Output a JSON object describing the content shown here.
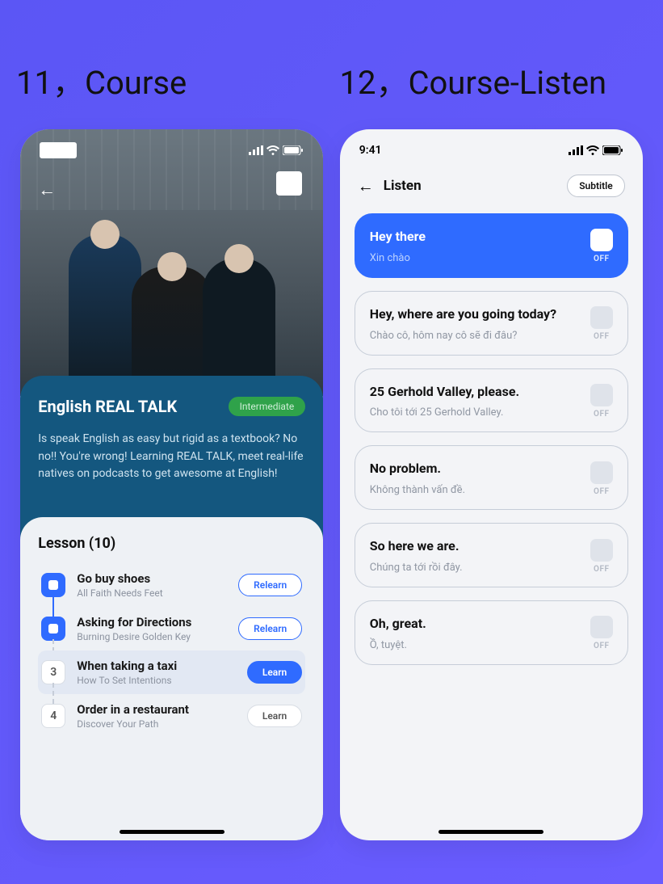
{
  "labels": {
    "left": "11，Course",
    "right": "12，Course-Listen"
  },
  "status": {
    "time": "9:41"
  },
  "course": {
    "title": "English REAL TALK",
    "level": "Intermediate",
    "description": "Is speak English as easy but rigid as a textbook? No no!! You're wrong! Learning REAL TALK, meet real-life natives on podcasts to get awesome at English!",
    "lessons_header": "Lesson (10)",
    "buttons": {
      "relearn": "Relearn",
      "learn": "Learn"
    },
    "lessons": [
      {
        "step": "",
        "name": "Go buy shoes",
        "sub": "All Faith Needs Feet",
        "action": "relearn",
        "done": true
      },
      {
        "step": "",
        "name": "Asking for Directions",
        "sub": "Burning Desire Golden Key",
        "action": "relearn",
        "done": true
      },
      {
        "step": "3",
        "name": "When taking a taxi",
        "sub": "How To Set Intentions",
        "action": "learn",
        "done": false,
        "active": true
      },
      {
        "step": "4",
        "name": "Order in a restaurant",
        "sub": "Discover Your Path",
        "action": "learn",
        "done": false,
        "plain": true
      }
    ]
  },
  "listen": {
    "title": "Listen",
    "subtitle_btn": "Subtitle",
    "toggle_label": "OFF",
    "items": [
      {
        "en": "Hey there",
        "vi": "Xin chào",
        "active": true
      },
      {
        "en": "Hey, where are you going today?",
        "vi": "Chào cô, hôm nay cô sẽ đi đâu?"
      },
      {
        "en": "25 Gerhold Valley, please.",
        "vi": "Cho tôi tới 25 Gerhold Valley."
      },
      {
        "en": "No problem.",
        "vi": "Không thành vấn đề."
      },
      {
        "en": "So here we are.",
        "vi": "Chúng ta tới rồi đây."
      },
      {
        "en": "Oh, great.",
        "vi": "Ồ, tuyệt."
      }
    ]
  }
}
